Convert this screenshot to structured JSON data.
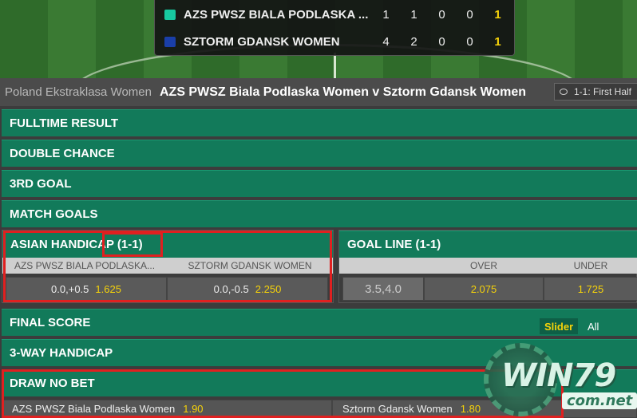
{
  "scoreboard": {
    "rows": [
      {
        "team": "AZS PWSZ BIALA PODLASKA ...",
        "shirt_color": "#17c9a0",
        "n1": "1",
        "n2": "1",
        "n3": "0",
        "n4": "0",
        "n5": "1"
      },
      {
        "team": "SZTORM GDANSK WOMEN",
        "shirt_color": "#1a3fa8",
        "n1": "4",
        "n2": "2",
        "n3": "0",
        "n4": "0",
        "n5": "1"
      }
    ]
  },
  "header": {
    "league": "Poland Ekstraklasa Women",
    "match": "AZS PWSZ Biala Podlaska Women v Sztorm Gdansk Women",
    "time_label": "1-1: First Half"
  },
  "markets": {
    "fulltime": "FULLTIME RESULT",
    "double_chance": "DOUBLE CHANCE",
    "third_goal": "3RD GOAL",
    "match_goals": "MATCH GOALS",
    "final_score": "FINAL SCORE",
    "three_way": "3-WAY HANDICAP",
    "draw_no_bet": "DRAW NO BET"
  },
  "asian": {
    "title": "ASIAN HANDICAP (1-1)",
    "col1": "AZS PWSZ BIALA PODLASKA...",
    "col2": "SZTORM GDANSK WOMEN",
    "line1": "0.0,+0.5",
    "odd1": "1.625",
    "line2": "0.0,-0.5",
    "odd2": "2.250"
  },
  "goal_line": {
    "title": "GOAL LINE (1-1)",
    "over": "OVER",
    "under": "UNDER",
    "line": "3.5,4.0",
    "over_odd": "2.075",
    "under_odd": "1.725"
  },
  "final_score_controls": {
    "slider": "Slider",
    "all": "All"
  },
  "dnb": {
    "home": "AZS PWSZ Biala Podlaska Women",
    "home_odd": "1.90",
    "away": "Sztorm Gdansk Women",
    "away_odd": "1.80"
  },
  "watermark": {
    "main": "WIN79",
    "sub": "com.net"
  },
  "colors": {
    "market_green": "#127a5a",
    "odds_yellow": "#f5d20a",
    "highlight_red": "#e02020"
  }
}
